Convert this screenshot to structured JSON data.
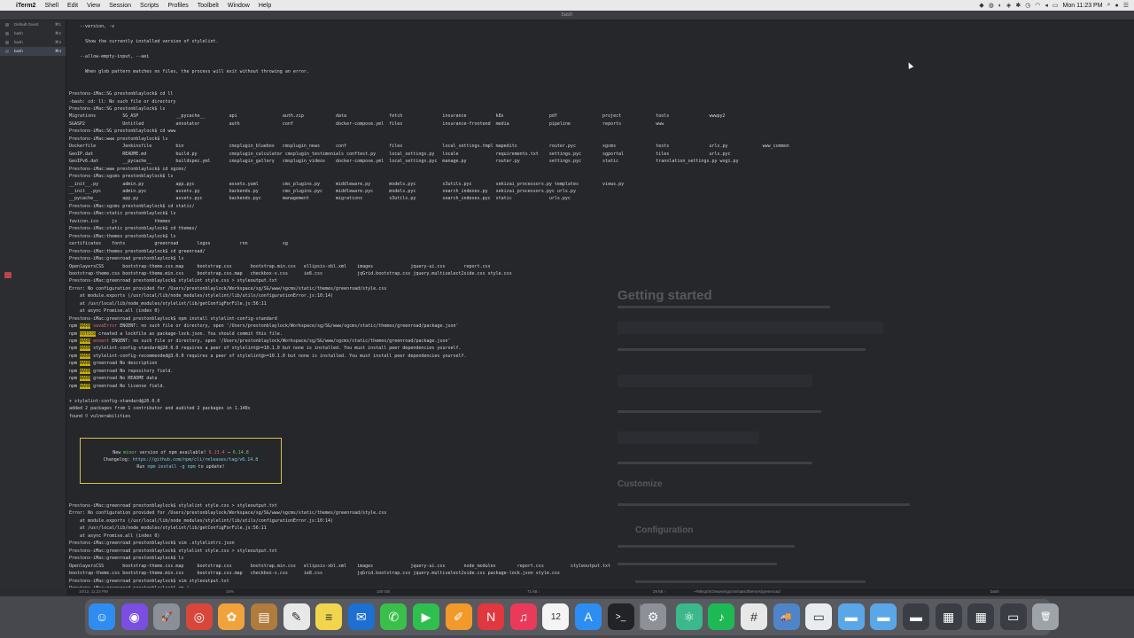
{
  "menubar": {
    "apple": "",
    "menus": [
      "iTerm2",
      "Shell",
      "Edit",
      "View",
      "Session",
      "Scripts",
      "Profiles",
      "Toolbelt",
      "Window",
      "Help"
    ],
    "clock": "Mon 11:23 PM"
  },
  "window": {
    "title": "bash"
  },
  "sidebar": {
    "sessions": [
      {
        "label": "Default Guest",
        "num": "⌘1"
      },
      {
        "label": "bash",
        "num": "⌘2"
      },
      {
        "label": "bash",
        "num": "⌘3"
      },
      {
        "label": "bash",
        "num": "⌘4"
      }
    ]
  },
  "terminal": {
    "lines": [
      {
        "t": "    --version, -v"
      },
      {
        "t": ""
      },
      {
        "t": "      Show the currently installed version of stylelint."
      },
      {
        "t": ""
      },
      {
        "t": "    --allow-empty-input, --aei"
      },
      {
        "t": ""
      },
      {
        "t": "      When glob pattern matches no files, the process will exit without throwing an error."
      },
      {
        "t": ""
      },
      {
        "t": ""
      },
      {
        "t": "Prestons-iMac:SG prestonblaylock$ cd ll"
      },
      {
        "t": "-bash: cd: ll: No such file or directory"
      },
      {
        "t": "Prestons-iMac:SG prestonblaylock$ ls"
      },
      {
        "t": "Migrations          SG_ASP              __pycache__         api                 auth.zip            data                fetch               insurance           k8s                 pdf                 project             tools               wwwpy2"
      },
      {
        "t": "SGASP2              Untitled            annotator           auth                conf                docker-compose.yml  files               insurance-frontend  media               pipeline            reports             www"
      },
      {
        "t": "Prestons-iMac:SG prestonblaylock$ cd www"
      },
      {
        "t": "Prestons-iMac:www prestonblaylock$ ls"
      },
      {
        "t": "Dockerfile          Jenkinsfile         bin                 cmsplugin_bluebox   cmsplugin_news      conf                files               local_settings.tmpl mapedits            router.pyc          sgcms               tests               urls.py             www_common"
      },
      {
        "t": "GeoIP.dat           README.md           build.py            cmsplugin_calculator cmsplugin_testimonials conftest.py     local_settings.py   locale              requirements.txt    settings.pyc        sgportal            tiles               urls.pyc"
      },
      {
        "t": "GeoIPv6.dat         __pycache__         buildspec.yml       cmsplugin_gallery   cmsplugin_videos    docker-compose.yml  local_settings.pyc  manage.py           router.py           settings.pyc        static              translation_settings.py wsgi.py"
      },
      {
        "t": "Prestons-iMac:www prestonblaylock$ cd sgcms/"
      },
      {
        "t": "Prestons-iMac:sgcms prestonblaylock$ ls"
      },
      {
        "t": "__init__.py         admin.py            app.pyc             assets.yaml         cms_plugins.py      middleware.py       models.pyc          s3utils.pyc         sekizai_processors.py templates         views.py"
      },
      {
        "t": "__init__.pyc        admin.pyc           assets.py           backends.py         cms_plugins.pyc     middleware.pyc      models.pyc          search_indexes.py   sekizai_processors.pyc urls.py"
      },
      {
        "t": "__pycache__         app.py              assets.pyc          backends.pyc        management          migrations          s3utils.py          search_indexes.pyc  static              urls.pyc"
      },
      {
        "t": "Prestons-iMac:sgcms prestonblaylock$ cd static/"
      },
      {
        "t": "Prestons-iMac:static prestonblaylock$ ls"
      },
      {
        "t": "favicon.ico     js              themes"
      },
      {
        "t": "Prestons-iMac:static prestonblaylock$ cd themes/"
      },
      {
        "t": "Prestons-iMac:themes prestonblaylock$ ls"
      },
      {
        "t": "certificates    fonts           greenroad       logos           rnn             sg"
      },
      {
        "t": "Prestons-iMac:themes prestonblaylock$ cd greenroad/"
      },
      {
        "t": "Prestons-iMac:greenroad prestonblaylock$ ls"
      },
      {
        "t": "OpenlayersCSS       bootstrap-theme.css.map     bootstrap.css       bootstrap.min.css   ellipsis-xbl.xml    images              jquery-ui.css       report.css"
      },
      {
        "t": "bootstrap-theme.css bootstrap-theme.min.css     bootstrap.css.map   checkbox-x.css      ie8.css             jqGrid.bootstrap.css jquery.multiselect2side.css style.css"
      },
      {
        "t": "Prestons-iMac:greenroad prestonblaylock$ stylelint style.css > styleoutput.txt"
      },
      {
        "t": "Error: No configuration provided for /Users/prestonblaylock/Workspace/sg/SG/www/sgcms/static/themes/greenroad/style.css"
      },
      {
        "t": "    at module.exports (/usr/local/lib/node_modules/stylelint/lib/utils/configurationError.js:10:14)"
      },
      {
        "t": "    at /usr/local/lib/node_modules/stylelint/lib/getConfigForFile.js:56:11"
      },
      {
        "t": "    at async Promise.all (index 0)"
      },
      {
        "t": "Prestons-iMac:greenroad prestonblaylock$ npm install stylelint-config-standard"
      },
      {
        "p": "npm ",
        "w": "WARN",
        "e": " saveError",
        "t": " ENOENT: no such file or directory, open '/Users/prestonblaylock/Workspace/sg/SG/www/sgcms/static/themes/greenroad/package.json'"
      },
      {
        "p": "npm ",
        "n": "notice",
        "t": " created a lockfile as package-lock.json. You should commit this file."
      },
      {
        "p": "npm ",
        "w": "WARN",
        "e": " enoent",
        "t": " ENOENT: no such file or directory, open '/Users/prestonblaylock/Workspace/sg/SG/www/sgcms/static/themes/greenroad/package.json'"
      },
      {
        "p": "npm ",
        "w": "WARN",
        "t": " stylelint-config-standard@20.0.0 requires a peer of stylelint@>=10.1.0 but none is installed. You must install peer dependencies yourself."
      },
      {
        "p": "npm ",
        "w": "WARN",
        "t": " stylelint-config-recommended@3.0.0 requires a peer of stylelint@>=10.1.0 but none is installed. You must install peer dependencies yourself."
      },
      {
        "p": "npm ",
        "w": "WARN",
        "t": " greenroad No description"
      },
      {
        "p": "npm ",
        "w": "WARN",
        "t": " greenroad No repository field."
      },
      {
        "p": "npm ",
        "w": "WARN",
        "t": " greenroad No README data"
      },
      {
        "p": "npm ",
        "w": "WARN",
        "t": " greenroad No license field."
      },
      {
        "t": ""
      },
      {
        "t": "+ stylelint-config-standard@20.0.0"
      },
      {
        "t": "added 2 packages from 1 contributor and audited 2 packages in 1.148s"
      },
      {
        "t": "found ",
        "g": "0",
        "t2": " vulnerabilities"
      },
      {
        "t": ""
      },
      {
        "t": ""
      },
      {
        "t": ""
      },
      {
        "t": ""
      },
      {
        "t": ""
      },
      {
        "t": ""
      },
      {
        "t": ""
      },
      {
        "t": ""
      },
      {
        "t": ""
      },
      {
        "t": ""
      },
      {
        "t": ""
      },
      {
        "t": "Prestons-iMac:greenroad prestonblaylock$ stylelint style.css > styleoutput.txt"
      },
      {
        "t": "Error: No configuration provided for /Users/prestonblaylock/Workspace/sg/SG/www/sgcms/static/themes/greenroad/style.css"
      },
      {
        "t": "    at module.exports (/usr/local/lib/node_modules/stylelint/lib/utils/configurationError.js:10:14)"
      },
      {
        "t": "    at /usr/local/lib/node_modules/stylelint/lib/getConfigForFile.js:56:11"
      },
      {
        "t": "    at async Promise.all (index 0)"
      },
      {
        "t": "Prestons-iMac:greenroad prestonblaylock$ vim .stylelintrc.json"
      },
      {
        "t": "Prestons-iMac:greenroad prestonblaylock$ stylelint style.css > styleoutput.txt"
      },
      {
        "t": "Prestons-iMac:greenroad prestonblaylock$ ls"
      },
      {
        "t": "OpenlayersCSS       bootstrap-theme.css.map     bootstrap.css       bootstrap.min.css   ellipsis-xbl.xml    images              jquery-ui.css       node_modules        report.css          styleoutput.txt"
      },
      {
        "t": "bootstrap-theme.css bootstrap-theme.min.css     bootstrap.css.map   checkbox-x.css      ie8.css             jqGrid.bootstrap.css jquery.multiselect2side.css package-lock.json style.css"
      },
      {
        "t": "Prestons-iMac:greenroad prestonblaylock$ vim styleoutput.txt"
      },
      {
        "t": "Prestons-iMac:greenroad prestonblaylock$ rm |"
      }
    ],
    "update_box": {
      "line1_a": "New ",
      "line1_minor": "minor",
      "line1_b": " version of npm available! ",
      "line1_old": "6.13.4",
      "line1_arrow": " → ",
      "line1_new": "6.14.8",
      "line2_a": "Changelog: ",
      "line2_link": "https://github.com/npm/cli/releases/tag/v6.14.8",
      "line3_a": "Run ",
      "line3_cmd": "npm install -g npm",
      "line3_b": " to update!"
    }
  },
  "background_doc": {
    "title": "Getting started",
    "sub1": "Customize",
    "sub2": "Configuration"
  },
  "statusbar": {
    "left": "10/12, 11:23 PM",
    "cpu": "10%",
    "disk": "100 GB",
    "mem": "71 kB ↓",
    "net": "29 kB ↑",
    "path": "~/Wksp/SG/www/sgcms/static/themes/greenroad",
    "right": "bash"
  },
  "dock": {
    "items": [
      {
        "name": "finder-icon",
        "glyph": "☺",
        "color": "#2f8cf0"
      },
      {
        "name": "siri-icon",
        "glyph": "◉",
        "color": "#7a4ee0"
      },
      {
        "name": "launchpad-icon",
        "glyph": "🚀",
        "color": "#8a8f98"
      },
      {
        "name": "chrome-icon",
        "glyph": "◎",
        "color": "#d9473b"
      },
      {
        "name": "photos-icon",
        "glyph": "✿",
        "color": "#f2a23a"
      },
      {
        "name": "notefile-icon",
        "glyph": "▤",
        "color": "#b07b3c"
      },
      {
        "name": "textedit-icon",
        "glyph": "✎",
        "color": "#e8e8e8"
      },
      {
        "name": "notes-icon",
        "glyph": "≡",
        "color": "#f1d54d"
      },
      {
        "name": "outlook-icon",
        "glyph": "✉",
        "color": "#1d6fd1"
      },
      {
        "name": "messages-icon",
        "glyph": "✆",
        "color": "#3ac04a"
      },
      {
        "name": "facetime-icon",
        "glyph": "▶",
        "color": "#2fbf4f"
      },
      {
        "name": "pages-icon",
        "glyph": "✐",
        "color": "#f19a2a"
      },
      {
        "name": "news-icon",
        "glyph": "N",
        "color": "#e0383e"
      },
      {
        "name": "music-icon",
        "glyph": "♫",
        "color": "#ea3a5a"
      },
      {
        "name": "calendar-icon",
        "glyph": "12",
        "color": "#f4f4f4"
      },
      {
        "name": "appstore-icon",
        "glyph": "A",
        "color": "#2c8ef2"
      },
      {
        "name": "terminal-icon",
        "glyph": ">_",
        "color": "#222326"
      },
      {
        "name": "system-preferences-icon",
        "glyph": "⚙",
        "color": "#8d9097"
      },
      {
        "name": "atom-icon",
        "glyph": "⚛",
        "color": "#3bb88c"
      },
      {
        "name": "spotify-icon",
        "glyph": "♪",
        "color": "#1db954"
      },
      {
        "name": "slack-icon",
        "glyph": "#",
        "color": "#e8e8e8"
      },
      {
        "name": "transmit-icon",
        "glyph": "🚚",
        "color": "#4f84c8"
      },
      {
        "name": "document-icon",
        "glyph": "▭",
        "color": "#e9ecef"
      },
      {
        "name": "folder-icon",
        "glyph": "▬",
        "color": "#5aa7e8"
      },
      {
        "name": "folder2-icon",
        "glyph": "▬",
        "color": "#5aa7e8"
      },
      {
        "name": "folder3-icon",
        "glyph": "▬",
        "color": "#3a3d44"
      },
      {
        "name": "screenshot-icon",
        "glyph": "▦",
        "color": "#3a3d44"
      },
      {
        "name": "screenshot2-icon",
        "glyph": "▦",
        "color": "#3a3d44"
      },
      {
        "name": "screen-icon",
        "glyph": "▭",
        "color": "#3a3d44"
      },
      {
        "name": "trash-icon",
        "glyph": "🗑",
        "color": "#9ea3aa"
      }
    ]
  }
}
